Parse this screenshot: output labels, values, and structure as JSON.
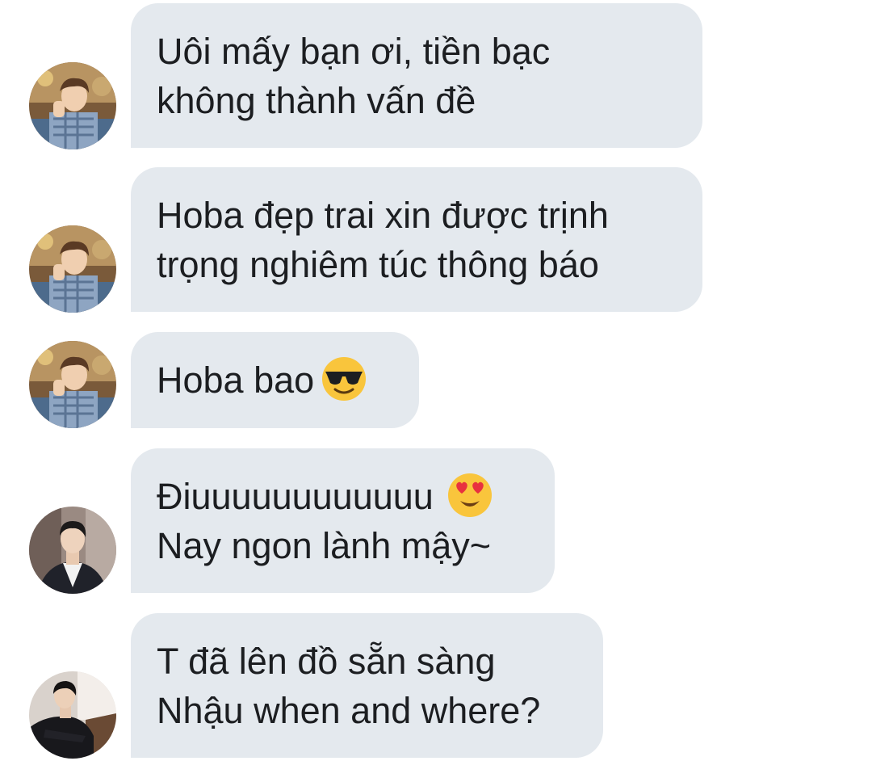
{
  "messages": [
    {
      "sender_avatar": "hoba-avatar",
      "lines": [
        "Uôi mấy bạn ơi, tiền bạc",
        "không thành vấn đề"
      ]
    },
    {
      "sender_avatar": "hoba-avatar",
      "lines": [
        "Hoba đẹp trai xin được trịnh",
        "trọng nghiêm túc thông báo"
      ]
    },
    {
      "sender_avatar": "hoba-avatar",
      "lines": [
        "Hoba bao"
      ],
      "emoji": "sunglasses-emoji"
    },
    {
      "sender_avatar": "jin-avatar",
      "lines": [
        "Điuuuuuuuuuuuu",
        "Nay ngon lành mậy~"
      ],
      "emoji": "heart-eyes-emoji"
    },
    {
      "sender_avatar": "jk-avatar",
      "lines": [
        "T đã lên đồ sẵn sàng",
        "Nhậu when and where?"
      ]
    }
  ],
  "colors": {
    "bubble": "#e4e9ee",
    "text": "#1c1e21",
    "background": "#ffffff"
  }
}
